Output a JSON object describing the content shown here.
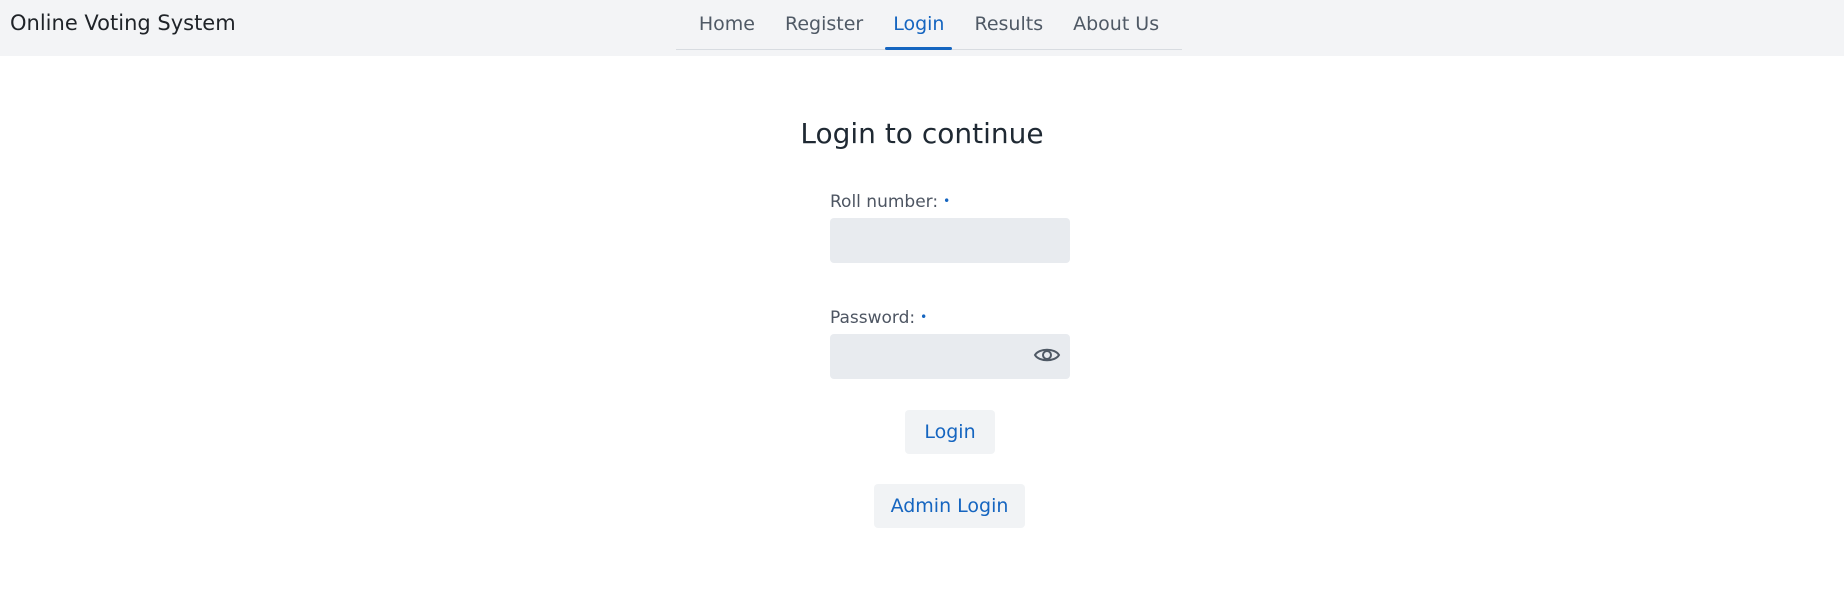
{
  "header": {
    "brand": "Online Voting System",
    "nav": [
      "Home",
      "Register",
      "Login",
      "Results",
      "About Us"
    ],
    "active_tab": "Login"
  },
  "form": {
    "title": "Login to continue",
    "roll_label": "Roll number:",
    "roll_value": "",
    "password_label": "Password:",
    "password_value": "",
    "required_marker": "•",
    "login_button": "Login",
    "admin_login_button": "Admin Login"
  },
  "colors": {
    "accent": "#1565c0",
    "header_bg": "#f3f4f6",
    "input_bg": "#e8ebef"
  },
  "icons": {
    "password_toggle": "eye-icon"
  }
}
